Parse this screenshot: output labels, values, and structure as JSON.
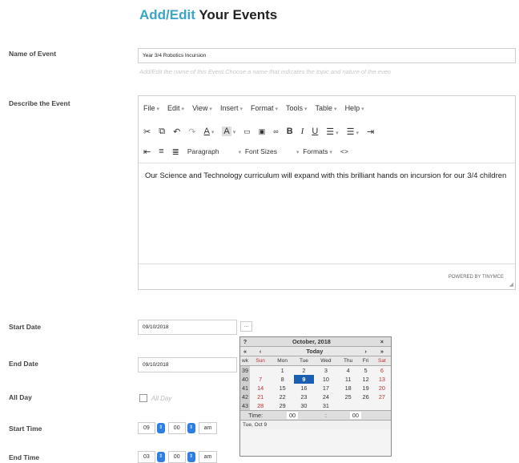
{
  "header": {
    "title_accent": "Add/Edit",
    "title_rest": "Your Events"
  },
  "form": {
    "name_label": "Name of Event",
    "name_value": "Year 3/4 Robotics Incursion",
    "name_hint": "Add/Edit the name of this Event.Choose a name that indicates the topic and nature of the even",
    "describe_label": "Describe the Event",
    "start_date_label": "Start Date",
    "start_date_value": "09/10/2018",
    "date_button": "...",
    "end_date_label": "End Date",
    "end_date_value": "09/10/2018",
    "all_day_label": "All Day",
    "all_day_checkbox_label": "All Day",
    "start_time_label": "Start Time",
    "start_time": {
      "hour": "09",
      "minute": "00",
      "ampm": "am"
    },
    "end_time_label": "End Time",
    "end_time": {
      "hour": "03",
      "minute": "00",
      "ampm": "am"
    }
  },
  "editor": {
    "menu": [
      "File",
      "Edit",
      "View",
      "Insert",
      "Format",
      "Tools",
      "Table",
      "Help"
    ],
    "toolbar_row1_icons": [
      "cut-icon",
      "copy-icon",
      "undo-icon",
      "redo-icon",
      "text-color-icon",
      "background-color-icon",
      "media-icon",
      "image-icon",
      "link-icon",
      "bold-icon",
      "italic-icon",
      "underline-icon",
      "bullet-list-icon",
      "numbered-list-icon",
      "indent-icon"
    ],
    "toolbar_row2": {
      "paragraph": "Paragraph",
      "font_sizes": "Font Sizes",
      "formats": "Formats",
      "code": "<>"
    },
    "content": "Our Science and Technology curriculum will expand with this brilliant hands on incursion for our 3/4 children",
    "status": "POWERED BY TINYMCE"
  },
  "calendar": {
    "help": "?",
    "month_title": "October, 2018",
    "close": "×",
    "nav": {
      "prev_year": "«",
      "prev_month": "‹",
      "today": "Today",
      "next_month": "›",
      "next_year": "»"
    },
    "day_headers": [
      "wk",
      "Sun",
      "Mon",
      "Tue",
      "Wed",
      "Thu",
      "Fri",
      "Sat"
    ],
    "weeks": [
      {
        "wk": "39",
        "days": [
          "",
          "1",
          "2",
          "3",
          "4",
          "5",
          "6"
        ]
      },
      {
        "wk": "40",
        "days": [
          "7",
          "8",
          "9",
          "10",
          "11",
          "12",
          "13"
        ]
      },
      {
        "wk": "41",
        "days": [
          "14",
          "15",
          "16",
          "17",
          "18",
          "19",
          "20"
        ]
      },
      {
        "wk": "42",
        "days": [
          "21",
          "22",
          "23",
          "24",
          "25",
          "26",
          "27"
        ]
      },
      {
        "wk": "43",
        "days": [
          "28",
          "29",
          "30",
          "31",
          "",
          "",
          ""
        ]
      }
    ],
    "selected_day": "9",
    "time_label": "Time:",
    "time_hour": "00",
    "time_minute": "00",
    "footer": "Tue, Oct 9",
    "colors": {
      "selected": "#1a5fb4",
      "weekend": "#c03030"
    }
  },
  "colors": {
    "accent": "#3aa5c6",
    "spinner": "#2f7fe0"
  }
}
